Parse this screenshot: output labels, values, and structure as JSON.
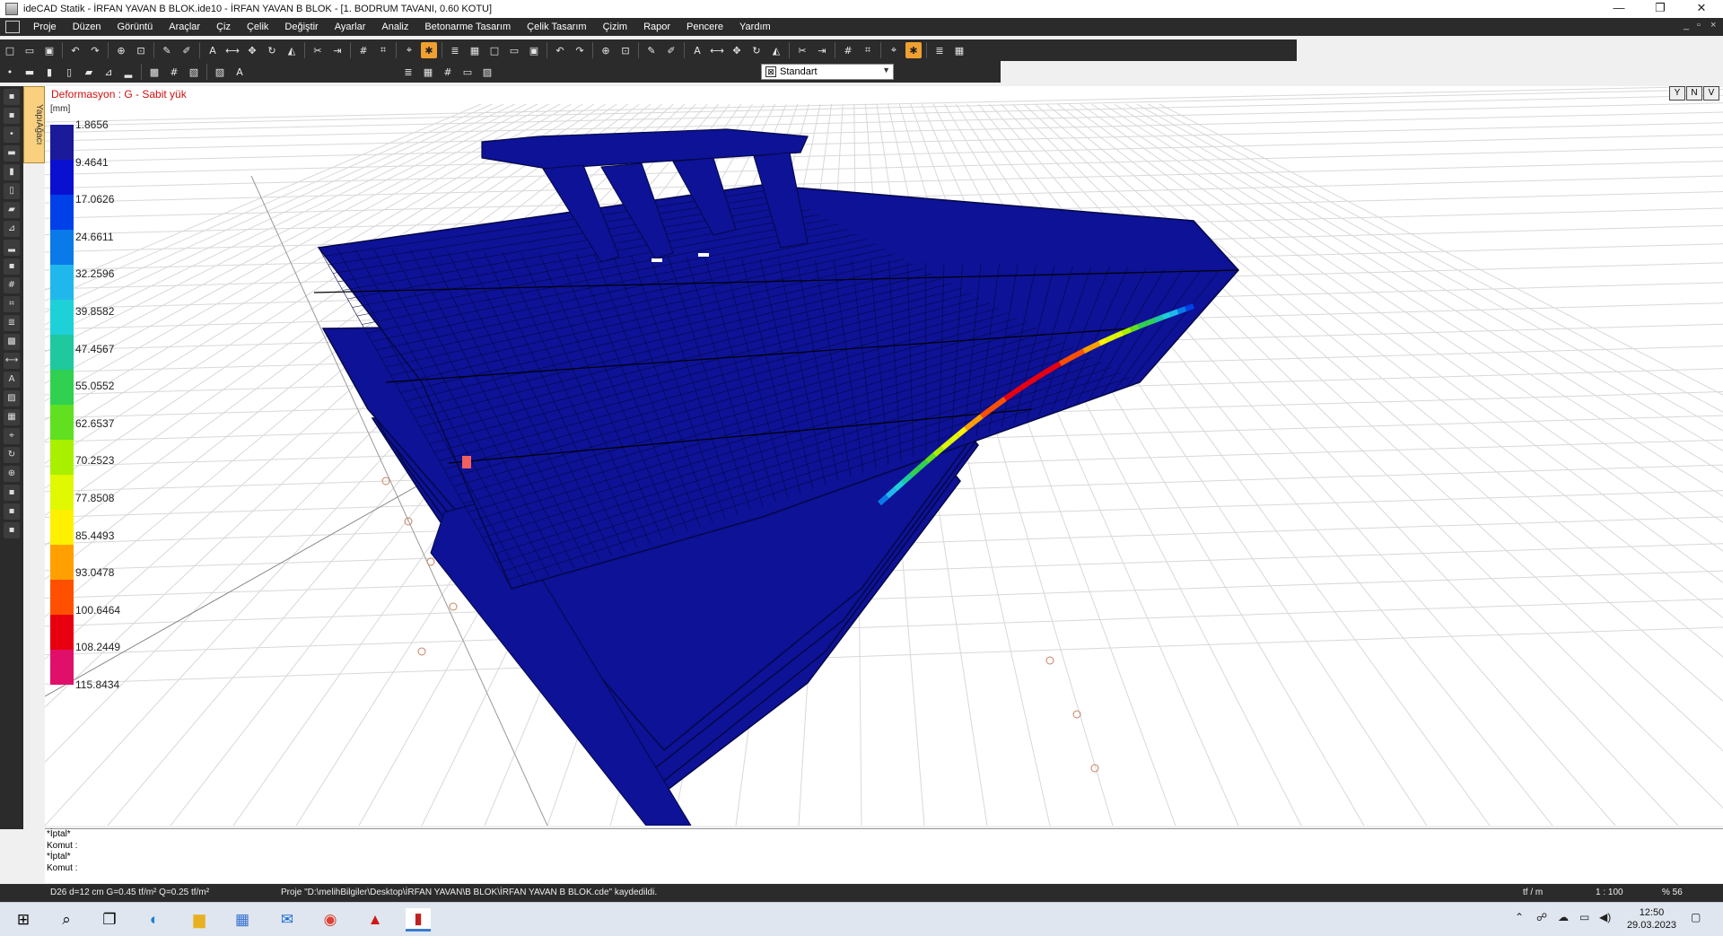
{
  "window": {
    "title": "ideCAD Statik - İRFAN YAVAN B BLOK.ide10 - İRFAN YAVAN B BLOK - [1. BODRUM TAVANI,  0.60 KOTU]",
    "controls": [
      "—",
      "❐",
      "✕"
    ]
  },
  "menu": [
    "Proje",
    "Düzen",
    "Görüntü",
    "Araçlar",
    "Çiz",
    "Çelik",
    "Değiştir",
    "Ayarlar",
    "Analiz",
    "Betonarme Tasarım",
    "Çelik Tasarım",
    "Çizim",
    "Rapor",
    "Pencere",
    "Yardım"
  ],
  "toolbar": {
    "style_select": "Standart",
    "row1_icons": [
      "new-icon",
      "open-icon",
      "save-icon",
      "sep",
      "undo-icon",
      "redo-icon",
      "sep",
      "zoom-icon",
      "zoom-window-icon",
      "sep",
      "pencil-icon",
      "pen-icon",
      "sep",
      "text-icon",
      "measure-icon",
      "move-icon",
      "rotate-icon",
      "mirror-icon",
      "sep",
      "trim-icon",
      "extend-icon",
      "sep",
      "grid-icon",
      "section-icon",
      "sep",
      "snap-icon",
      "snap-active-icon",
      "sep",
      "layer-icon",
      "table-icon"
    ],
    "row2_icons": [
      "node-icon",
      "beam-icon",
      "column-icon",
      "wall-icon",
      "slab-icon",
      "stair-icon",
      "foundation-icon",
      "sep",
      "mesh-icon",
      "grid-icon",
      "hatch-icon",
      "sep",
      "image-icon",
      "text-icon",
      "line-icon",
      "circle-icon",
      "rect-icon",
      "sep",
      "layer-icon",
      "table-icon"
    ]
  },
  "sidebar": {
    "tree_tab": "YapıAğacı"
  },
  "viewport": {
    "result_label": "Deformasyon : G  -  Sabit yük",
    "unit": "[mm]",
    "view_buttons": [
      "Y",
      "N",
      "V"
    ],
    "legend": {
      "values": [
        "1.8656",
        "9.4641",
        "17.0626",
        "24.6611",
        "32.2596",
        "39.8582",
        "47.4567",
        "55.0552",
        "62.6537",
        "70.2523",
        "77.8508",
        "85.4493",
        "93.0478",
        "100.6464",
        "108.2449",
        "115.8434"
      ],
      "colors": [
        "#1a1a9a",
        "#0a10d0",
        "#0040e8",
        "#0a7ae8",
        "#20b8ec",
        "#1ed0d8",
        "#20c8a0",
        "#30d050",
        "#60e020",
        "#a8f000",
        "#e0f800",
        "#fff000",
        "#ffa000",
        "#ff5000",
        "#e80010",
        "#e0106a"
      ]
    },
    "colors": {
      "slab": "#0d1296",
      "mesh": "#050845",
      "grid": "#d8d8d8"
    }
  },
  "command": {
    "lines": [
      "*İptal*",
      "Komut :",
      "*İptal*",
      "Komut :"
    ]
  },
  "status": {
    "element": "D26 d=12 cm G=0.45 tf/m² Q=0.25 tf/m²",
    "message": "Proje \"D:\\melihBilgiler\\Desktop\\İRFAN YAVAN\\B BLOK\\İRFAN YAVAN B BLOK.cde\" kaydedildi.",
    "units": "tf / m",
    "scale": "1 : 100",
    "zoom": "% 56"
  },
  "taskbar": {
    "apps": [
      "start-icon",
      "search-icon",
      "task-view-icon",
      "edge-icon",
      "explorer-icon",
      "store-icon",
      "mail-icon",
      "chrome-icon",
      "autocad-icon",
      "idecad-icon"
    ],
    "time": "12:50",
    "date": "29.03.2023"
  }
}
